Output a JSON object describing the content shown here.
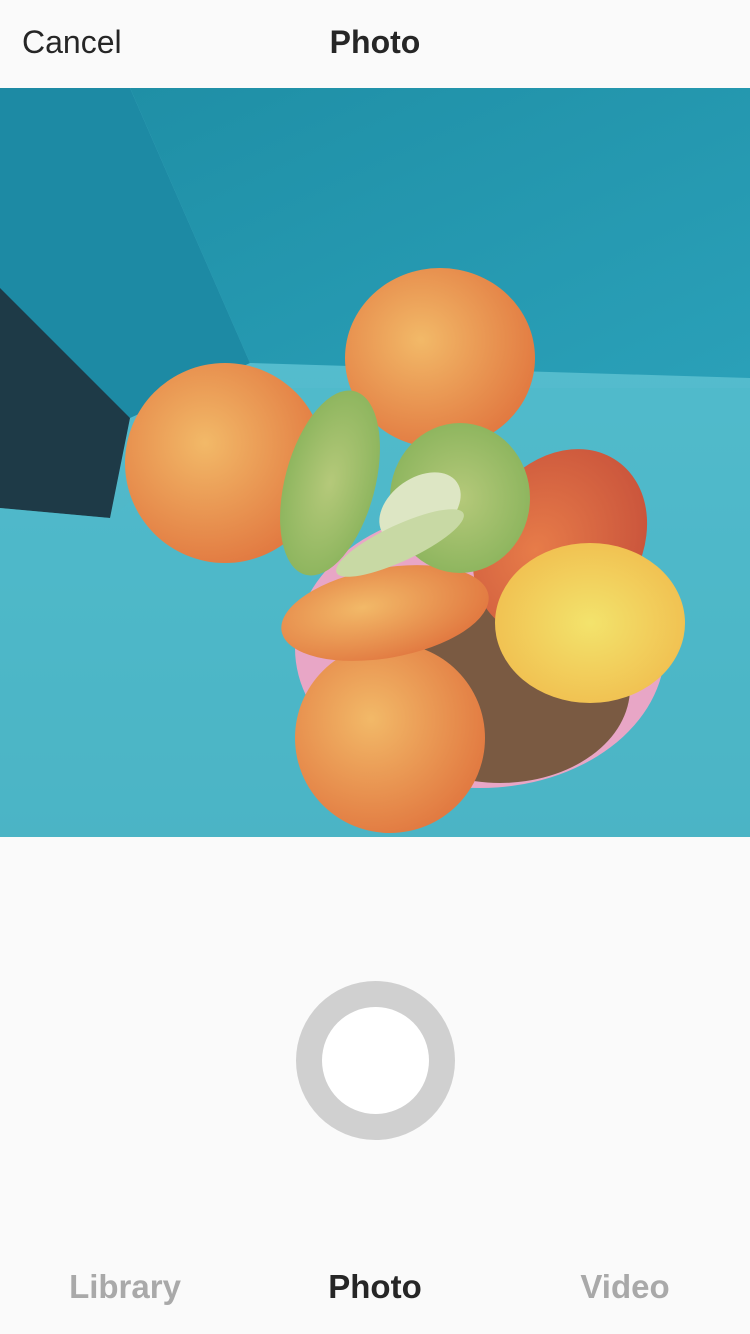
{
  "header": {
    "cancel_label": "Cancel",
    "title": "Photo"
  },
  "camera": {
    "shutter_color": "#d0d0d0",
    "shutter_inner_color": "#ffffff"
  },
  "tabs": [
    {
      "label": "Library",
      "active": false
    },
    {
      "label": "Photo",
      "active": true
    },
    {
      "label": "Video",
      "active": false
    }
  ],
  "colors": {
    "text_primary": "#262626",
    "text_inactive": "#a9a9a9",
    "background": "#fafafa"
  }
}
